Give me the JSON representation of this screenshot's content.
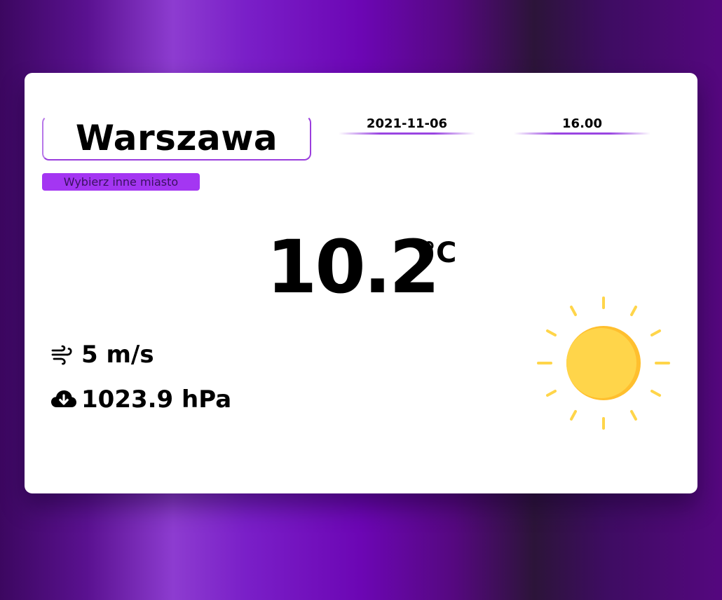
{
  "location": {
    "city": "Warszawa",
    "change_label": "Wybierz inne miasto"
  },
  "datetime": {
    "date": "2021-11-06",
    "time": "16.00"
  },
  "weather": {
    "temperature": "10.2",
    "unit": "°C",
    "wind": "5 m/s",
    "pressure": "1023.9 hPa",
    "condition_icon": "sun-icon"
  },
  "icons": {
    "wind": "wind-icon",
    "pressure": "cloud-download-icon"
  },
  "colors": {
    "accent": "#a436f2",
    "sun": "#ffd54a",
    "sun_shadow": "#ffbf2e"
  }
}
